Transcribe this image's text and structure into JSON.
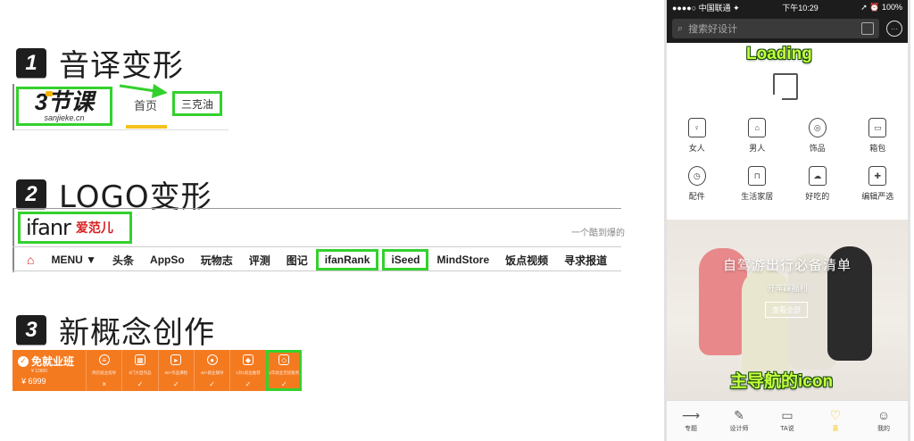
{
  "sections": [
    {
      "number": "1",
      "title": "音译变形"
    },
    {
      "number": "2",
      "title": "LOGO变形"
    },
    {
      "number": "3",
      "title": "新概念创作"
    }
  ],
  "sec1": {
    "logo_mark": "3节课",
    "logo_domain": "sanjieke.cn",
    "nav_home": "首页",
    "nav_boxed": "三克油"
  },
  "sec2": {
    "logo_en": "ifanr",
    "logo_zh": "爱范儿",
    "slogan": "一个酷到爆的",
    "nav": [
      "MENU ▼",
      "头条",
      "AppSo",
      "玩物志",
      "评测",
      "图记",
      "ifanRank",
      "iSeed",
      "MindStore",
      "饭点视频",
      "寻求报道"
    ],
    "boxed_items": [
      "ifanRank",
      "iSeed"
    ]
  },
  "sec3": {
    "title": "免就业班",
    "sub": "¥ 12800",
    "price": "¥ 6999",
    "items": [
      {
        "cap": "简历就业指导",
        "status": "×"
      },
      {
        "cap": "8门大型作品",
        "status": "✓"
      },
      {
        "cap": "80+作品课程",
        "status": "✓"
      },
      {
        "cap": "48+就业辅导",
        "status": "✓"
      },
      {
        "cap": "1对1就业推荐",
        "status": "✓"
      },
      {
        "cap": "1年就业无忧服务",
        "status": "✓"
      }
    ]
  },
  "phone": {
    "status_left": "●●●●○ 中国联通 ✦",
    "status_time": "下午10:29",
    "status_right": "➚ ⏰ 100%",
    "search_placeholder": "搜索好设计",
    "label_loading": "Loading",
    "label_icon": "主导航的icon",
    "categories": [
      "女人",
      "男人",
      "饰品",
      "箱包",
      "配件",
      "生活家居",
      "好吃的",
      "编辑严选"
    ],
    "banner_title": "自驾游出行必备清单",
    "banner_sub": "开车踩福利",
    "banner_button": "查看全部",
    "tabs": [
      "专题",
      "设计师",
      "TA说",
      "喜",
      "我的"
    ]
  },
  "colors": {
    "highlight": "#34d12e",
    "badge_bg": "#1e1e1e",
    "orange_bar": "#f47a20",
    "accent_yellow": "#f4c21b",
    "ifanr_red": "#d62020"
  }
}
